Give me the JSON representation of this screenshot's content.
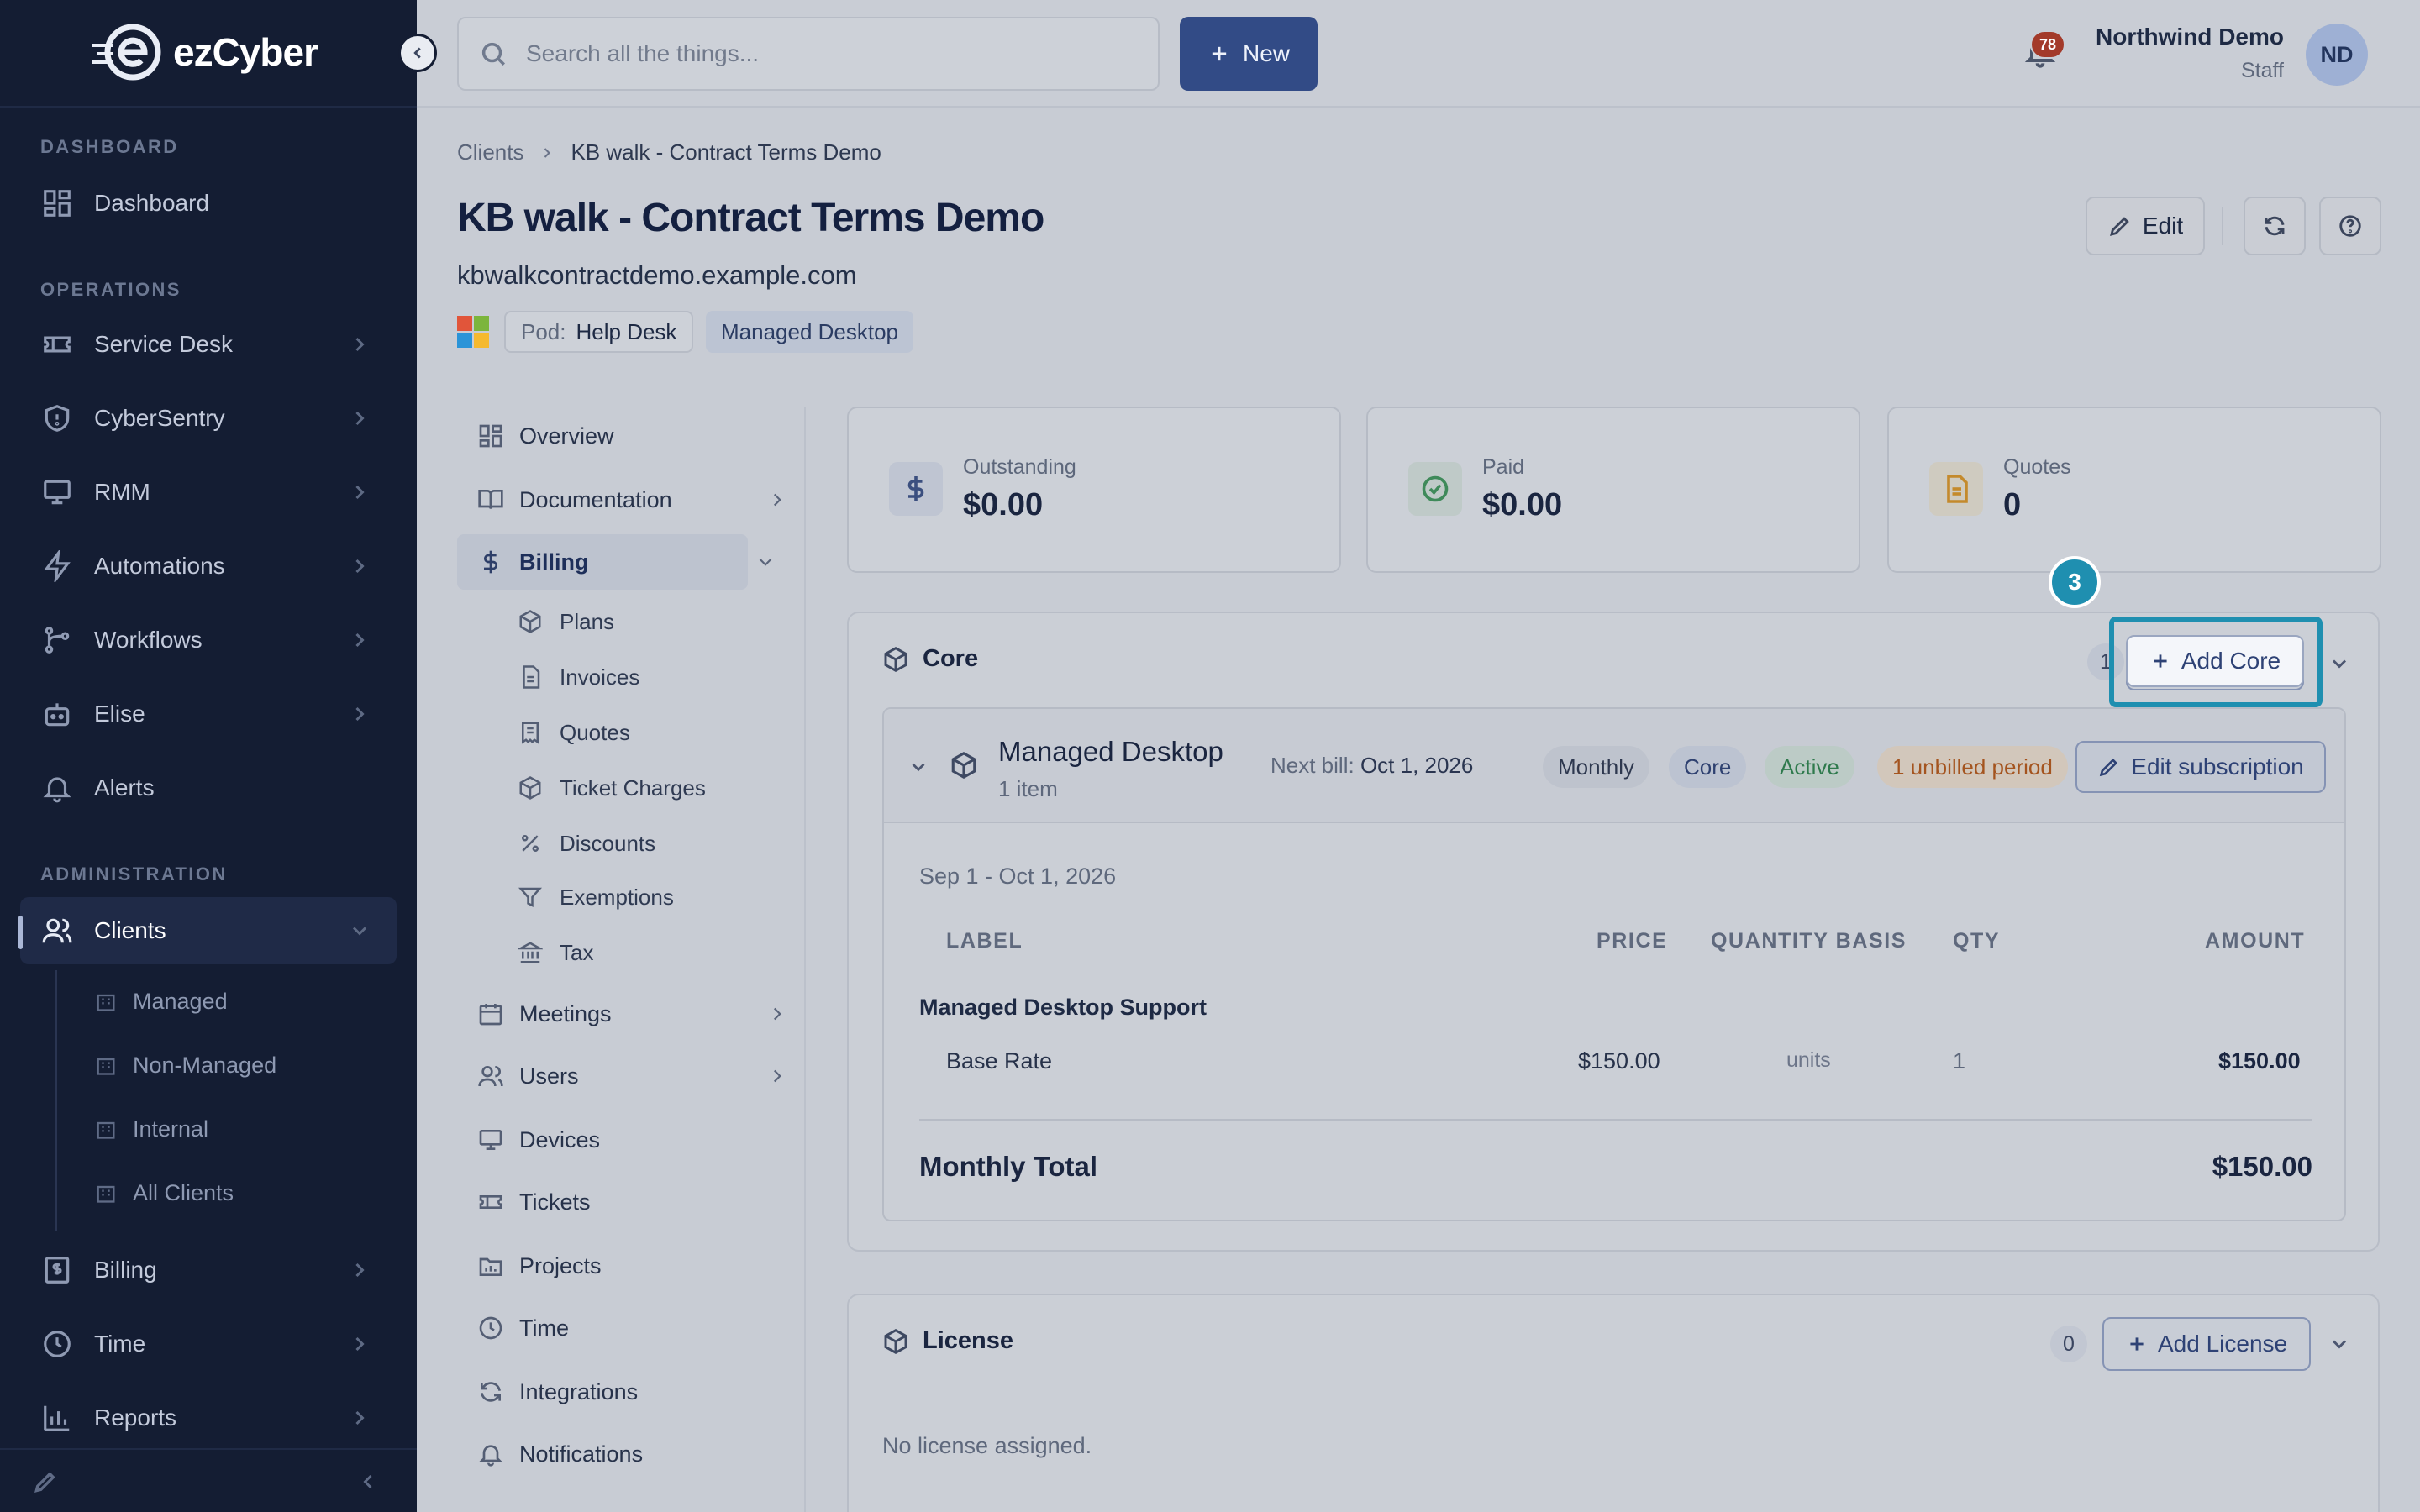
{
  "app": {
    "logo_text": "ezCyber"
  },
  "sidebar": {
    "sections": {
      "dashboard": "DASHBOARD",
      "operations": "OPERATIONS",
      "administration": "ADMINISTRATION"
    },
    "items": [
      {
        "label": "Dashboard",
        "icon": "dashboard-icon"
      },
      {
        "label": "Service Desk",
        "icon": "ticket-icon"
      },
      {
        "label": "CyberSentry",
        "icon": "shield-icon"
      },
      {
        "label": "RMM",
        "icon": "monitor-icon"
      },
      {
        "label": "Automations",
        "icon": "bolt-icon"
      },
      {
        "label": "Workflows",
        "icon": "workflow-icon"
      },
      {
        "label": "Elise",
        "icon": "bot-icon"
      },
      {
        "label": "Alerts",
        "icon": "bell-icon"
      },
      {
        "label": "Clients",
        "icon": "users-icon",
        "active": true
      },
      {
        "label": "Billing",
        "icon": "invoice-icon"
      },
      {
        "label": "Time",
        "icon": "clock-icon"
      },
      {
        "label": "Reports",
        "icon": "chart-icon"
      }
    ],
    "clients_sub": [
      "Managed",
      "Non-Managed",
      "Internal",
      "All Clients"
    ]
  },
  "topbar": {
    "search_placeholder": "Search all the things...",
    "new_label": "New",
    "notifications_count": "78",
    "user_name": "Northwind Demo",
    "user_role": "Staff",
    "avatar_initials": "ND"
  },
  "breadcrumb": {
    "root": "Clients",
    "current": "KB walk - Contract Terms Demo"
  },
  "client": {
    "title": "KB walk - Contract Terms Demo",
    "domain": "kbwalkcontractdemo.example.com",
    "pod_key": "Pod:",
    "pod_value": "Help Desk",
    "plan_tag": "Managed Desktop"
  },
  "header_actions": {
    "edit_label": "Edit"
  },
  "subnav": {
    "items": [
      "Overview",
      "Documentation",
      "Billing",
      "Meetings",
      "Users",
      "Devices",
      "Tickets",
      "Projects",
      "Time",
      "Integrations",
      "Notifications"
    ],
    "billing_sub": [
      "Plans",
      "Invoices",
      "Quotes",
      "Ticket Charges",
      "Discounts",
      "Exemptions",
      "Tax"
    ]
  },
  "stats": [
    {
      "label": "Outstanding",
      "value": "$0.00",
      "icon": "dollar-icon",
      "color": "#3b4f7f"
    },
    {
      "label": "Paid",
      "value": "$0.00",
      "icon": "check-circle-icon",
      "color": "#3f8a5a"
    },
    {
      "label": "Quotes",
      "value": "0",
      "icon": "document-icon",
      "color": "#c48a2c"
    }
  ],
  "core": {
    "title": "Core",
    "count": "1",
    "add_label": "Add Core",
    "subscription": {
      "name": "Managed Desktop",
      "items": "1 item",
      "next_bill_label": "Next bill:",
      "next_bill_date": "Oct 1, 2026",
      "tags": [
        "Monthly",
        "Core",
        "Active",
        "1 unbilled period"
      ],
      "edit_label": "Edit subscription",
      "period": "Sep 1 - Oct 1, 2026",
      "columns": [
        "LABEL",
        "PRICE",
        "QUANTITY BASIS",
        "QTY",
        "AMOUNT"
      ],
      "group": "Managed Desktop Support",
      "rows": [
        {
          "label": "Base Rate",
          "price": "$150.00",
          "basis": "units",
          "qty": "1",
          "amount": "$150.00"
        }
      ],
      "total_label": "Monthly Total",
      "total_value": "$150.00"
    }
  },
  "license": {
    "title": "License",
    "count": "0",
    "add_label": "Add License",
    "empty": "No license assigned."
  },
  "overlay": {
    "step": "3"
  }
}
